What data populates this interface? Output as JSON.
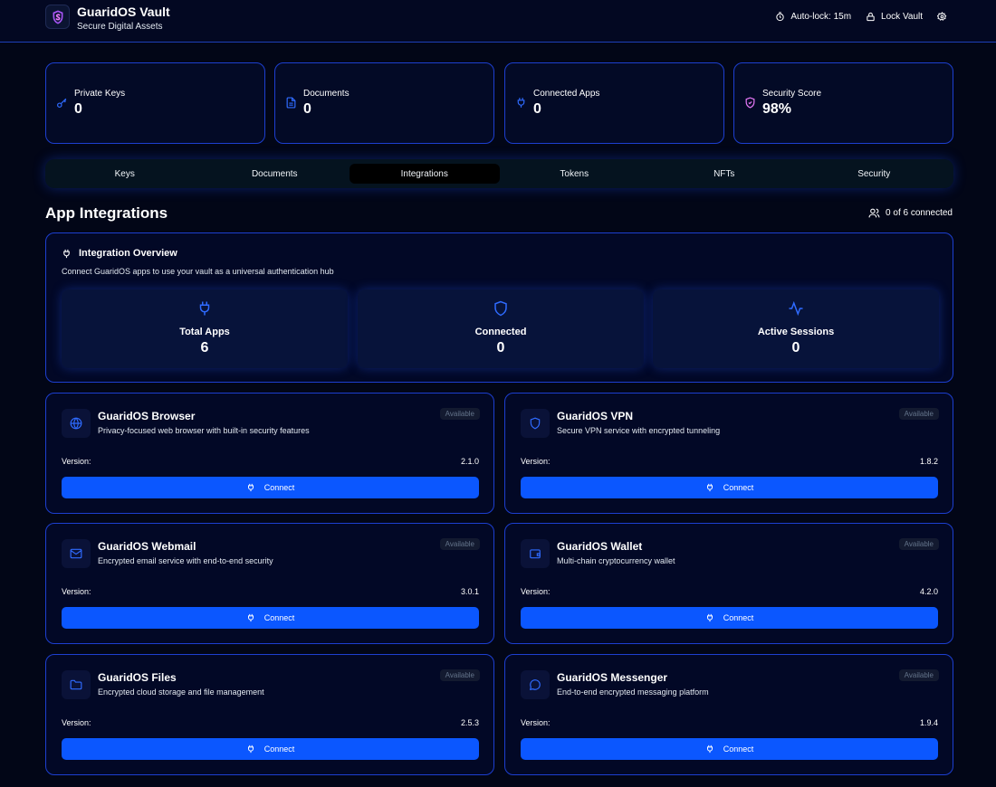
{
  "header": {
    "title": "GuaridOS Vault",
    "subtitle": "Secure Digital Assets",
    "autolock_label": "Auto-lock: 15m",
    "lock_label": "Lock Vault"
  },
  "stats": [
    {
      "label": "Private Keys",
      "value": "0"
    },
    {
      "label": "Documents",
      "value": "0"
    },
    {
      "label": "Connected Apps",
      "value": "0"
    },
    {
      "label": "Security Score",
      "value": "98%"
    }
  ],
  "tabs": [
    "Keys",
    "Documents",
    "Integrations",
    "Tokens",
    "NFTs",
    "Security"
  ],
  "active_tab": "Integrations",
  "section": {
    "title": "App Integrations",
    "connected_count": "0 of 6 connected"
  },
  "overview": {
    "title": "Integration Overview",
    "description": "Connect GuaridOS apps to use your vault as a universal authentication hub",
    "stats": [
      {
        "label": "Total Apps",
        "value": "6",
        "icon": "plug-icon"
      },
      {
        "label": "Connected",
        "value": "0",
        "icon": "shield-icon"
      },
      {
        "label": "Active Sessions",
        "value": "0",
        "icon": "activity-icon"
      }
    ]
  },
  "apps": [
    {
      "name": "GuaridOS Browser",
      "description": "Privacy-focused web browser with built-in security features",
      "badge": "Available",
      "version_label": "Version:",
      "version": "2.1.0",
      "button": "Connect",
      "icon": "globe-icon"
    },
    {
      "name": "GuaridOS VPN",
      "description": "Secure VPN service with encrypted tunneling",
      "badge": "Available",
      "version_label": "Version:",
      "version": "1.8.2",
      "button": "Connect",
      "icon": "shield-icon"
    },
    {
      "name": "GuaridOS Webmail",
      "description": "Encrypted email service with end-to-end security",
      "badge": "Available",
      "version_label": "Version:",
      "version": "3.0.1",
      "button": "Connect",
      "icon": "mail-icon"
    },
    {
      "name": "GuaridOS Wallet",
      "description": "Multi-chain cryptocurrency wallet",
      "badge": "Available",
      "version_label": "Version:",
      "version": "4.2.0",
      "button": "Connect",
      "icon": "wallet-icon"
    },
    {
      "name": "GuaridOS Files",
      "description": "Encrypted cloud storage and file management",
      "badge": "Available",
      "version_label": "Version:",
      "version": "2.5.3",
      "button": "Connect",
      "icon": "folder-icon"
    },
    {
      "name": "GuaridOS Messenger",
      "description": "End-to-end encrypted messaging platform",
      "badge": "Available",
      "version_label": "Version:",
      "version": "1.9.4",
      "button": "Connect",
      "icon": "message-icon"
    }
  ],
  "colors": {
    "background": "#020617",
    "accent": "#0b57ff",
    "border": "#1d3fd0",
    "security_score_icon": "#e879f9"
  }
}
